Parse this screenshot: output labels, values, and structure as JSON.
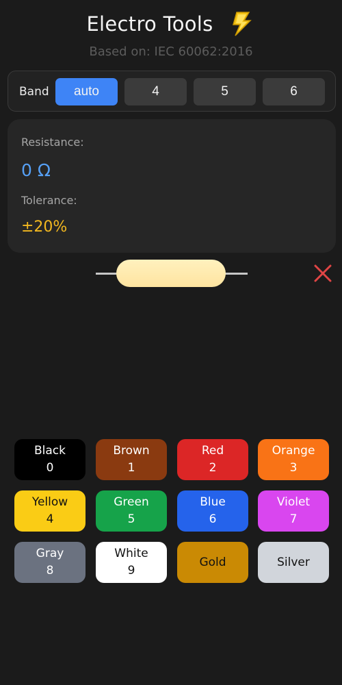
{
  "header": {
    "title": "Electro Tools",
    "subtitle": "Based on: IEC 60062:2016"
  },
  "band_selector": {
    "label": "Band",
    "options": [
      "auto",
      "4",
      "5",
      "6"
    ],
    "selected": "auto"
  },
  "result": {
    "resistance_label": "Resistance:",
    "resistance_value": "0 Ω",
    "tolerance_label": "Tolerance:",
    "tolerance_value": "±20%"
  },
  "resistor": {
    "bands": [],
    "body_color": "#ffe8aa",
    "clear_icon": "close-icon"
  },
  "colors": {
    "accent": "#3e84f6",
    "resistance_value": "#56a0f5",
    "tolerance_value": "#f3b81f",
    "clear": "#e04545"
  },
  "palette": [
    {
      "name": "Black",
      "digit": "0",
      "bg": "#000000",
      "fg": "#ffffff"
    },
    {
      "name": "Brown",
      "digit": "1",
      "bg": "#8a3a10",
      "fg": "#ffffff"
    },
    {
      "name": "Red",
      "digit": "2",
      "bg": "#dc2626",
      "fg": "#ffffff"
    },
    {
      "name": "Orange",
      "digit": "3",
      "bg": "#f97316",
      "fg": "#ffffff"
    },
    {
      "name": "Yellow",
      "digit": "4",
      "bg": "#facc15",
      "fg": "#111111"
    },
    {
      "name": "Green",
      "digit": "5",
      "bg": "#16a34a",
      "fg": "#ffffff"
    },
    {
      "name": "Blue",
      "digit": "6",
      "bg": "#2563eb",
      "fg": "#ffffff"
    },
    {
      "name": "Violet",
      "digit": "7",
      "bg": "#d946ef",
      "fg": "#ffffff"
    },
    {
      "name": "Gray",
      "digit": "8",
      "bg": "#6b7280",
      "fg": "#ffffff"
    },
    {
      "name": "White",
      "digit": "9",
      "bg": "#ffffff",
      "fg": "#111111"
    },
    {
      "name": "Gold",
      "digit": "",
      "bg": "#ca8a04",
      "fg": "#111111"
    },
    {
      "name": "Silver",
      "digit": "",
      "bg": "#d1d5db",
      "fg": "#111111"
    }
  ]
}
